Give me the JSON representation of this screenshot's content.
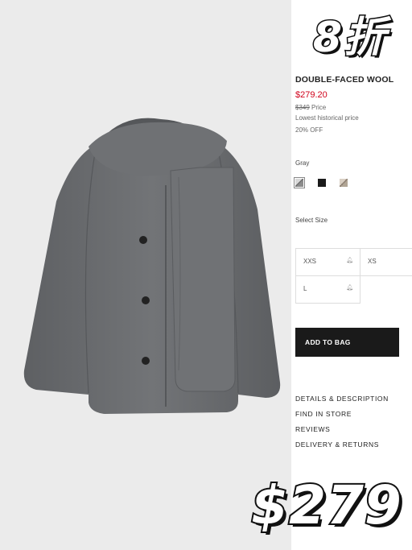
{
  "product": {
    "name": "DOUBLE-FACED WOOL",
    "price_current": "$279.20",
    "price_original": "$349",
    "price_original_suffix": "Price",
    "lowest_price_note": "Lowest historical price",
    "discount": "20% OFF"
  },
  "color": {
    "label": "Gray",
    "swatches": [
      "gray",
      "black",
      "beige"
    ]
  },
  "sizes": {
    "label": "Select Size",
    "options": [
      "XXS",
      "XS",
      "L"
    ]
  },
  "cart": {
    "add_label": "ADD TO BAG"
  },
  "links": [
    "DETAILS & DESCRIPTION",
    "FIND IN STORE",
    "REVIEWS",
    "DELIVERY & RETURNS"
  ],
  "overlay": {
    "discount_sticker": "8折",
    "price_sticker": "$279"
  },
  "colors": {
    "price_red": "#d0021b",
    "button_bg": "#1a1a1a",
    "coat_gray": "#6b6d70"
  }
}
